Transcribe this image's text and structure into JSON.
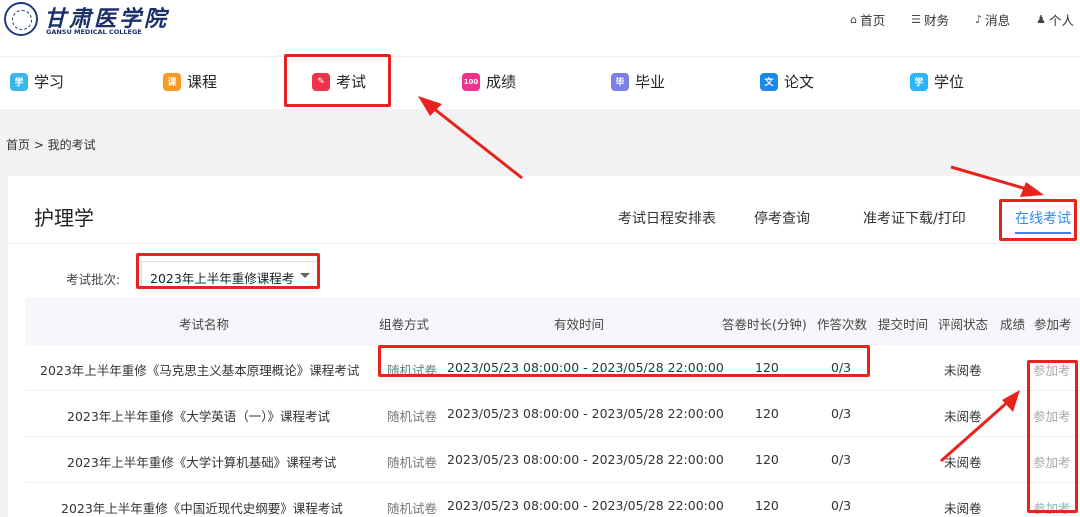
{
  "header": {
    "logo_cn": "甘肃医学院",
    "logo_en": "GANSU MEDICAL COLLEGE",
    "links": [
      {
        "icon": "home-icon",
        "glyph": "⌂",
        "label": "首页"
      },
      {
        "icon": "finance-icon",
        "glyph": "☰",
        "label": "财务"
      },
      {
        "icon": "bell-icon",
        "glyph": "♪",
        "label": "消息"
      },
      {
        "icon": "user-icon",
        "glyph": "♟",
        "label": "个人"
      }
    ]
  },
  "nav": {
    "items": [
      {
        "label": "学习",
        "icon": "study-icon",
        "color": "#3ab6e8",
        "glyph": "学"
      },
      {
        "label": "课程",
        "icon": "course-icon",
        "color": "#f59a23",
        "glyph": "课"
      },
      {
        "label": "考试",
        "icon": "exam-icon",
        "color": "#f0324b",
        "glyph": "✎"
      },
      {
        "label": "成绩",
        "icon": "score-icon",
        "color": "#f0328c",
        "glyph": "100"
      },
      {
        "label": "毕业",
        "icon": "graduate-icon",
        "color": "#7b7fe8",
        "glyph": "毕"
      },
      {
        "label": "论文",
        "icon": "thesis-icon",
        "color": "#1e88e5",
        "glyph": "文"
      },
      {
        "label": "学位",
        "icon": "degree-icon",
        "color": "#29b6f6",
        "glyph": "学"
      }
    ]
  },
  "breadcrumb": "首页 > 我的考试",
  "card": {
    "title": "护理学",
    "tabs": [
      "考试日程安排表",
      "停考查询",
      "准考证下载/打印",
      "在线考试"
    ],
    "active_tab": "在线考试"
  },
  "filter": {
    "label": "考试批次:",
    "selected": "2023年上半年重修课程考"
  },
  "table": {
    "columns": [
      "考试名称",
      "组卷方式",
      "有效时间",
      "答卷时长(分钟)",
      "作答次数",
      "提交时间",
      "评阅状态",
      "成绩",
      "参加考"
    ],
    "rows": [
      {
        "name": "2023年上半年重修《马克思主义基本原理概论》课程考试",
        "method": "随机试卷",
        "time": "2023/05/23 08:00:00 - 2023/05/28 22:00:00",
        "duration": "120",
        "attempts": "0/3",
        "submit": "",
        "status": "未阅卷",
        "score": "",
        "action": "参加考"
      },
      {
        "name": "2023年上半年重修《大学英语（一）》课程考试",
        "method": "随机试卷",
        "time": "2023/05/23 08:00:00 - 2023/05/28 22:00:00",
        "duration": "120",
        "attempts": "0/3",
        "submit": "",
        "status": "未阅卷",
        "score": "",
        "action": "参加考"
      },
      {
        "name": "2023年上半年重修《大学计算机基础》课程考试",
        "method": "随机试卷",
        "time": "2023/05/23 08:00:00 - 2023/05/28 22:00:00",
        "duration": "120",
        "attempts": "0/3",
        "submit": "",
        "status": "未阅卷",
        "score": "",
        "action": "参加考"
      },
      {
        "name": "2023年上半年重修《中国近现代史纲要》课程考试",
        "method": "随机试卷",
        "time": "2023/05/23 08:00:00 - 2023/05/28 22:00:00",
        "duration": "120",
        "attempts": "0/3",
        "submit": "",
        "status": "未阅卷",
        "score": "",
        "action": "参加考"
      }
    ]
  },
  "colors": {
    "accent": "#2d8cf0",
    "annotation": "#e8231e"
  }
}
